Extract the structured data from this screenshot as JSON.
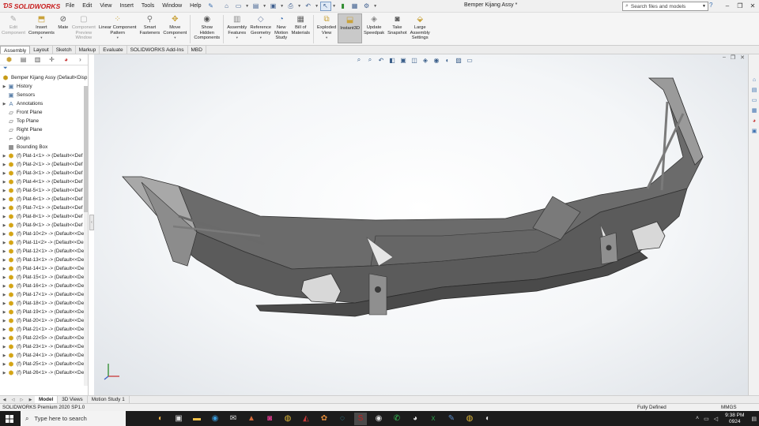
{
  "app": {
    "brand": "SOLIDWORKS",
    "document_title": "Bemper Kijang Assy *",
    "menu": [
      "File",
      "Edit",
      "View",
      "Insert",
      "Tools",
      "Window",
      "Help"
    ],
    "search_placeholder": "Search files and models",
    "colors": {
      "brand_red": "#c81e1e",
      "accent_blue": "#3a6fb0",
      "part_yellow": "#d4a516"
    }
  },
  "ribbon": {
    "buttons": [
      {
        "id": "edit-component",
        "label": "Edit\nComponent",
        "icon": "edit-icon",
        "disabled": true
      },
      {
        "id": "insert-components",
        "label": "Insert\nComponents",
        "icon": "insert-components-icon",
        "disabled": false
      },
      {
        "id": "mate",
        "label": "Mate",
        "icon": "mate-icon",
        "disabled": false
      },
      {
        "id": "component-preview",
        "label": "Component\nPreview\nWindow",
        "icon": "preview-window-icon",
        "disabled": true
      },
      {
        "id": "linear-pattern",
        "label": "Linear Component\nPattern",
        "icon": "pattern-icon",
        "disabled": false
      },
      {
        "id": "smart-fasteners",
        "label": "Smart\nFasteners",
        "icon": "fastener-icon",
        "disabled": false
      },
      {
        "id": "move-component",
        "label": "Move\nComponent",
        "icon": "move-icon",
        "disabled": false
      },
      {
        "id": "show-hidden",
        "label": "Show\nHidden\nComponents",
        "icon": "show-hidden-icon",
        "disabled": false
      },
      {
        "id": "assembly-features",
        "label": "Assembly\nFeatures",
        "icon": "assembly-features-icon",
        "disabled": false
      },
      {
        "id": "reference-geometry",
        "label": "Reference\nGeometry",
        "icon": "reference-geometry-icon",
        "disabled": false
      },
      {
        "id": "new-motion-study",
        "label": "New\nMotion\nStudy",
        "icon": "motion-study-icon",
        "disabled": false
      },
      {
        "id": "bill-of-materials",
        "label": "Bill of\nMaterials",
        "icon": "bom-icon",
        "disabled": false
      },
      {
        "id": "exploded-view",
        "label": "Exploded\nView",
        "icon": "exploded-view-icon",
        "disabled": false
      },
      {
        "id": "instant3d",
        "label": "Instant3D",
        "icon": "instant3d-icon",
        "disabled": false,
        "active": true
      },
      {
        "id": "update-speedpak",
        "label": "Update\nSpeedpak",
        "icon": "speedpak-icon",
        "disabled": false
      },
      {
        "id": "take-snapshot",
        "label": "Take\nSnapshot",
        "icon": "snapshot-icon",
        "disabled": false
      },
      {
        "id": "large-assembly",
        "label": "Large\nAssembly\nSettings",
        "icon": "large-assembly-icon",
        "disabled": false
      }
    ]
  },
  "command_tabs": [
    "Assembly",
    "Layout",
    "Sketch",
    "Markup",
    "Evaluate",
    "SOLIDWORKS Add-Ins",
    "MBD"
  ],
  "feature_tree": {
    "root": "Bemper Kijang Assy  (Default<Disp",
    "items": [
      {
        "label": "History",
        "icon": "folder-icon",
        "expandable": true
      },
      {
        "label": "Sensors",
        "icon": "folder-icon",
        "expandable": false
      },
      {
        "label": "Annotations",
        "icon": "annotation-icon",
        "expandable": true
      },
      {
        "label": "Front Plane",
        "icon": "plane-icon",
        "expandable": false
      },
      {
        "label": "Top Plane",
        "icon": "plane-icon",
        "expandable": false
      },
      {
        "label": "Right Plane",
        "icon": "plane-icon",
        "expandable": false
      },
      {
        "label": "Origin",
        "icon": "origin-icon",
        "expandable": false
      },
      {
        "label": "Bounding Box",
        "icon": "bounding-box-icon",
        "expandable": false
      },
      {
        "label": "(f) Plat-1<1> -> (Default<<Def",
        "icon": "part-icon",
        "expandable": true
      },
      {
        "label": "(f) Plat-2<1> -> (Default<<Def",
        "icon": "part-icon",
        "expandable": true
      },
      {
        "label": "(f) Plat-3<1> -> (Default<<Def",
        "icon": "part-icon",
        "expandable": true
      },
      {
        "label": "(f) Plat-4<1> -> (Default<<Def",
        "icon": "part-icon",
        "expandable": true
      },
      {
        "label": "(f) Plat-5<1> -> (Default<<Def",
        "icon": "part-icon",
        "expandable": true
      },
      {
        "label": "(f) Plat-6<1> -> (Default<<Def",
        "icon": "part-icon",
        "expandable": true
      },
      {
        "label": "(f) Plat-7<1> -> (Default<<Def",
        "icon": "part-icon",
        "expandable": true
      },
      {
        "label": "(f) Plat-8<1> -> (Default<<Def",
        "icon": "part-icon",
        "expandable": true
      },
      {
        "label": "(f) Plat-9<1> -> (Default<<Def",
        "icon": "part-icon",
        "expandable": true
      },
      {
        "label": "(f) Plat-10<2> -> (Default<<De",
        "icon": "part-icon",
        "expandable": true
      },
      {
        "label": "(f) Plat-11<2> -> (Default<<De",
        "icon": "part-icon",
        "expandable": true
      },
      {
        "label": "(f) Plat-12<1> -> (Default<<De",
        "icon": "part-icon",
        "expandable": true
      },
      {
        "label": "(f) Plat-13<1> -> (Default<<De",
        "icon": "part-icon",
        "expandable": true
      },
      {
        "label": "(f) Plat-14<1> -> (Default<<De",
        "icon": "part-icon",
        "expandable": true
      },
      {
        "label": "(f) Plat-15<1> -> (Default<<De",
        "icon": "part-icon",
        "expandable": true
      },
      {
        "label": "(f) Plat-16<1> -> (Default<<De",
        "icon": "part-icon",
        "expandable": true
      },
      {
        "label": "(f) Plat-17<1> -> (Default<<De",
        "icon": "part-icon",
        "expandable": true
      },
      {
        "label": "(f) Plat-18<1> -> (Default<<De",
        "icon": "part-icon",
        "expandable": true
      },
      {
        "label": "(f) Plat-19<1> -> (Default<<De",
        "icon": "part-icon",
        "expandable": true
      },
      {
        "label": "(f) Plat-20<1> -> (Default<<De",
        "icon": "part-icon",
        "expandable": true
      },
      {
        "label": "(f) Plat-21<1> -> (Default<<De",
        "icon": "part-icon",
        "expandable": true
      },
      {
        "label": "(f) Plat-22<5> -> (Default<<De",
        "icon": "part-icon",
        "expandable": true
      },
      {
        "label": "(f) Plat-23<1> -> (Default<<De",
        "icon": "part-icon",
        "expandable": true
      },
      {
        "label": "(f) Plat-24<1> -> (Default<<De",
        "icon": "part-icon",
        "expandable": true
      },
      {
        "label": "(f) Plat-25<1> -> (Default<<De",
        "icon": "part-icon",
        "expandable": true
      },
      {
        "label": "(f) Plat-26<1> -> (Default<<De",
        "icon": "part-icon",
        "expandable": true
      }
    ]
  },
  "bottom_tabs": [
    "Model",
    "3D Views",
    "Motion Study 1"
  ],
  "status": {
    "product": "SOLIDWORKS Premium 2020 SP1.0",
    "definition": "Fully Defined",
    "units": "MMGS"
  },
  "taskbar": {
    "search_placeholder": "Type here to search",
    "time": "9:38 PM",
    "date": "0924"
  }
}
